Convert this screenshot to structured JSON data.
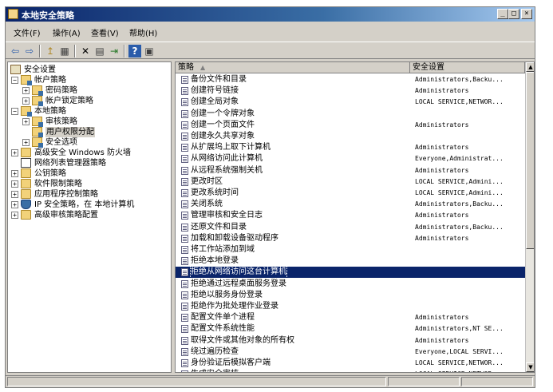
{
  "window": {
    "title": "本地安全策略",
    "minimize_glyph": "_",
    "maximize_glyph": "□",
    "close_glyph": "×"
  },
  "menubar": [
    {
      "label": "文件(F)"
    },
    {
      "label": "操作(A)"
    },
    {
      "label": "查看(V)"
    },
    {
      "label": "帮助(H)"
    }
  ],
  "toolbar": [
    {
      "icon": "back-icon",
      "glyph": "⇦"
    },
    {
      "icon": "forward-icon",
      "glyph": "⇨"
    },
    {
      "icon": "up-folder-icon",
      "glyph": "↥"
    },
    {
      "icon": "show-hide-tree-icon",
      "glyph": "▦"
    },
    {
      "icon": "delete-icon",
      "glyph": "✕"
    },
    {
      "icon": "properties-icon",
      "glyph": "▤"
    },
    {
      "icon": "export-list-icon",
      "glyph": "⇥"
    },
    {
      "icon": "help-icon",
      "glyph": "?"
    },
    {
      "icon": "console-view-icon",
      "glyph": "▣"
    }
  ],
  "tree": [
    {
      "label": "安全设置",
      "level": 0,
      "expander": "",
      "icon": "security-settings-icon"
    },
    {
      "label": "帐户策略",
      "level": 1,
      "expander": "−",
      "icon": "folder-icon"
    },
    {
      "label": "密码策略",
      "level": 2,
      "expander": "+",
      "icon": "folder-icon"
    },
    {
      "label": "帐户锁定策略",
      "level": 2,
      "expander": "+",
      "icon": "folder-icon"
    },
    {
      "label": "本地策略",
      "level": 1,
      "expander": "−",
      "icon": "folder-icon"
    },
    {
      "label": "审核策略",
      "level": 2,
      "expander": "+",
      "icon": "folder-icon"
    },
    {
      "label": "用户权限分配",
      "level": 2,
      "expander": "",
      "icon": "folder-icon",
      "selected": true
    },
    {
      "label": "安全选项",
      "level": 2,
      "expander": "+",
      "icon": "folder-icon"
    },
    {
      "label": "高级安全 Windows 防火墙",
      "level": 1,
      "expander": "+",
      "icon": "firewall-folder-icon"
    },
    {
      "label": "网络列表管理器策略",
      "level": 1,
      "expander": "",
      "icon": "network-list-icon"
    },
    {
      "label": "公钥策略",
      "level": 1,
      "expander": "+",
      "icon": "folder-icon"
    },
    {
      "label": "软件限制策略",
      "level": 1,
      "expander": "+",
      "icon": "folder-icon"
    },
    {
      "label": "应用程序控制策略",
      "level": 1,
      "expander": "+",
      "icon": "folder-icon"
    },
    {
      "label": "IP 安全策略，在 本地计算机",
      "level": 1,
      "expander": "+",
      "icon": "ipsec-shield-icon"
    },
    {
      "label": "高级审核策略配置",
      "level": 1,
      "expander": "+",
      "icon": "folder-icon"
    }
  ],
  "list": {
    "columns": {
      "policy": "策略",
      "setting": "安全设置",
      "sort_glyph": "▲"
    },
    "rows": [
      {
        "policy": "备份文件和目录",
        "setting": "Administrators,Backu..."
      },
      {
        "policy": "创建符号链接",
        "setting": "Administrators"
      },
      {
        "policy": "创建全局对象",
        "setting": "LOCAL SERVICE,NETWOR..."
      },
      {
        "policy": "创建一个令牌对象",
        "setting": ""
      },
      {
        "policy": "创建一个页面文件",
        "setting": "Administrators"
      },
      {
        "policy": "创建永久共享对象",
        "setting": ""
      },
      {
        "policy": "从扩展坞上取下计算机",
        "setting": "Administrators"
      },
      {
        "policy": "从网络访问此计算机",
        "setting": "Everyone,Administrat..."
      },
      {
        "policy": "从远程系统强制关机",
        "setting": "Administrators"
      },
      {
        "policy": "更改时区",
        "setting": "LOCAL SERVICE,Admini..."
      },
      {
        "policy": "更改系统时间",
        "setting": "LOCAL SERVICE,Admini..."
      },
      {
        "policy": "关闭系统",
        "setting": "Administrators,Backu..."
      },
      {
        "policy": "管理审核和安全日志",
        "setting": "Administrators"
      },
      {
        "policy": "还原文件和目录",
        "setting": "Administrators,Backu..."
      },
      {
        "policy": "加载和卸载设备驱动程序",
        "setting": "Administrators"
      },
      {
        "policy": "将工作站添加到域",
        "setting": ""
      },
      {
        "policy": "拒绝本地登录",
        "setting": ""
      },
      {
        "policy": "拒绝从网络访问这台计算机",
        "setting": "",
        "selected": true
      },
      {
        "policy": "拒绝通过远程桌面服务登录",
        "setting": ""
      },
      {
        "policy": "拒绝以服务身份登录",
        "setting": ""
      },
      {
        "policy": "拒绝作为批处理作业登录",
        "setting": ""
      },
      {
        "policy": "配置文件单个进程",
        "setting": "Administrators"
      },
      {
        "policy": "配置文件系统性能",
        "setting": "Administrators,NT SE..."
      },
      {
        "policy": "取得文件或其他对象的所有权",
        "setting": "Administrators"
      },
      {
        "policy": "绕过遍历检查",
        "setting": "Everyone,LOCAL SERVI..."
      },
      {
        "policy": "身份验证后模拟客户端",
        "setting": "LOCAL SERVICE,NETWOR..."
      },
      {
        "policy": "生成安全审核",
        "setting": "LOCAL SERVICE,NETWOR..."
      }
    ]
  },
  "scrollbar": {
    "up_glyph": "▲",
    "down_glyph": "▼"
  }
}
